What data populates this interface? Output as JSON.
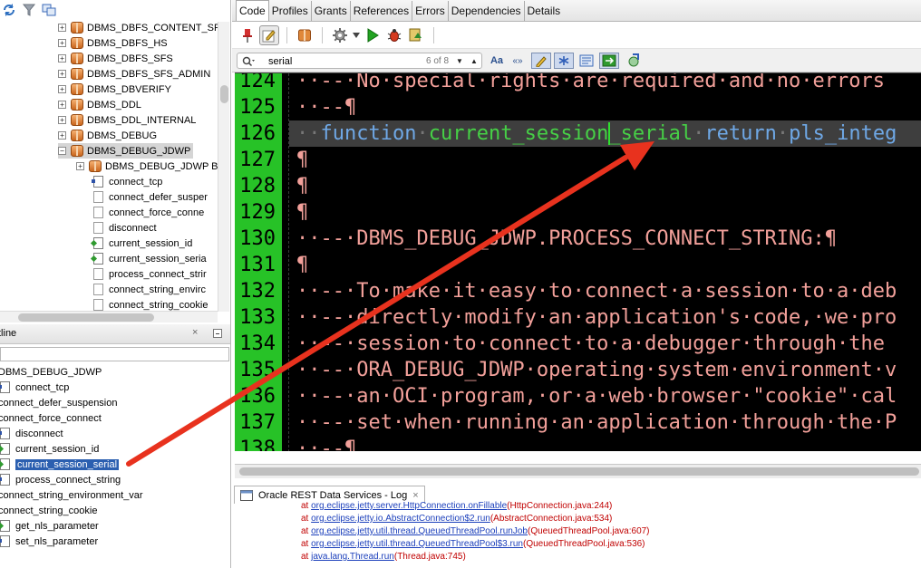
{
  "left_tree": {
    "toolbar_icons": [
      "refresh-icon",
      "filter-icon",
      "schema-browser-icon"
    ],
    "items": [
      {
        "label": "DBMS_DBFS_CONTENT_SP",
        "kind": "package",
        "expander": "+"
      },
      {
        "label": "DBMS_DBFS_HS",
        "kind": "package",
        "expander": "+"
      },
      {
        "label": "DBMS_DBFS_SFS",
        "kind": "package",
        "expander": "+"
      },
      {
        "label": "DBMS_DBFS_SFS_ADMIN",
        "kind": "package",
        "expander": "+"
      },
      {
        "label": "DBMS_DBVERIFY",
        "kind": "package",
        "expander": "+"
      },
      {
        "label": "DBMS_DDL",
        "kind": "package",
        "expander": "+"
      },
      {
        "label": "DBMS_DDL_INTERNAL",
        "kind": "package",
        "expander": "+"
      },
      {
        "label": "DBMS_DEBUG",
        "kind": "package",
        "expander": "+"
      },
      {
        "label": "DBMS_DEBUG_JDWP",
        "kind": "package",
        "expander": "−"
      },
      {
        "label": "DBMS_DEBUG_JDWP Bo",
        "kind": "package",
        "expander": "+"
      },
      {
        "label": "connect_tcp",
        "kind": "procedure"
      },
      {
        "label": "connect_defer_susper",
        "kind": "plain"
      },
      {
        "label": "connect_force_conne",
        "kind": "plain"
      },
      {
        "label": "disconnect",
        "kind": "plain"
      },
      {
        "label": "current_session_id",
        "kind": "function"
      },
      {
        "label": "current_session_seria",
        "kind": "function"
      },
      {
        "label": "process_connect_strir",
        "kind": "plain"
      },
      {
        "label": "connect_string_envirc",
        "kind": "plain"
      },
      {
        "label": "connect_string_cookie",
        "kind": "plain"
      }
    ]
  },
  "outline": {
    "title": "tline",
    "close_glyph": "×",
    "root": "DBMS_DEBUG_JDWP",
    "items": [
      {
        "label": "connect_tcp",
        "kind": "procedure"
      },
      {
        "label": "connect_defer_suspension",
        "kind": "plain"
      },
      {
        "label": "connect_force_connect",
        "kind": "plain"
      },
      {
        "label": "disconnect",
        "kind": "procedure"
      },
      {
        "label": "current_session_id",
        "kind": "function"
      },
      {
        "label": "current_session_serial",
        "kind": "function",
        "selected": true
      },
      {
        "label": "process_connect_string",
        "kind": "procedure"
      },
      {
        "label": "connect_string_environment_var",
        "kind": "plain"
      },
      {
        "label": "connect_string_cookie",
        "kind": "plain"
      },
      {
        "label": "get_nls_parameter",
        "kind": "function"
      },
      {
        "label": "set_nls_parameter",
        "kind": "procedure"
      }
    ]
  },
  "editor_tabs": [
    {
      "label": "Code",
      "active": true
    },
    {
      "label": "Profiles"
    },
    {
      "label": "Grants"
    },
    {
      "label": "References"
    },
    {
      "label": "Errors"
    },
    {
      "label": "Dependencies"
    },
    {
      "label": "Details"
    }
  ],
  "editor_toolbar_icons": [
    "pin-icon",
    "edit-icon",
    "package-icon",
    "gear-icon",
    "run-icon",
    "debug-bug-icon",
    "compile-icon"
  ],
  "find": {
    "value": "serial",
    "count": "6 of 8",
    "prev_glyph": "▼",
    "next_glyph": "▲",
    "match_case_label": "Aa",
    "whole_word_label": "«»"
  },
  "code_lines": [
    {
      "num": "124",
      "text": "··--·No·special·rights·are·required·and·no·errors"
    },
    {
      "num": "125",
      "text": "··--¶"
    },
    {
      "num": "126",
      "text": "··function·current_session_serial·return·pls_integ",
      "current": true
    },
    {
      "num": "127",
      "text": "¶"
    },
    {
      "num": "128",
      "text": "¶"
    },
    {
      "num": "129",
      "text": "¶"
    },
    {
      "num": "130",
      "text": "··--·DBMS_DEBUG_JDWP.PROCESS_CONNECT_STRING:¶"
    },
    {
      "num": "131",
      "text": "¶"
    },
    {
      "num": "132",
      "text": "··--·To·make·it·easy·to·connect·a·session·to·a·deb"
    },
    {
      "num": "133",
      "text": "··--·directly·modify·an·application's·code,·we·pro"
    },
    {
      "num": "134",
      "text": "··--·session·to·connect·to·a·debugger·through·the"
    },
    {
      "num": "135",
      "text": "··--·ORA_DEBUG_JDWP·operating·system·environment·v"
    },
    {
      "num": "136",
      "text": "··--·an·OCI·program,·or·a·web·browser·\"cookie\"·cal"
    },
    {
      "num": "137",
      "text": "··--·set·when·running·an·application·through·the·P"
    },
    {
      "num": "138",
      "text": "··--¶"
    }
  ],
  "log": {
    "tab_label": "Oracle REST Data Services - Log",
    "close_glyph": "×",
    "lines": [
      {
        "at": "at ",
        "link": "org.eclipse.jetty.server.HttpConnection.onFillable",
        "src": "(HttpConnection.java:244)"
      },
      {
        "at": "at ",
        "link": "org.eclipse.jetty.io.AbstractConnection$2.run",
        "src": "(AbstractConnection.java:534)"
      },
      {
        "at": "at ",
        "link": "org.eclipse.jetty.util.thread.QueuedThreadPool.runJob",
        "src": "(QueuedThreadPool.java:607)"
      },
      {
        "at": "at ",
        "link": "org.eclipse.jetty.util.thread.QueuedThreadPool$3.run",
        "src": "(QueuedThreadPool.java:536)"
      },
      {
        "at": "at ",
        "link": "java.lang.Thread.run",
        "src": "(Thread.java:745)"
      }
    ]
  },
  "colors": {
    "gutter": "#27c227",
    "editor_bg": "#000000",
    "comment": "#f2a09a",
    "keyword": "#6fa8e6",
    "identifier": "#46d046",
    "selection": "#2b5fb0",
    "arrow": "#e8321e"
  }
}
